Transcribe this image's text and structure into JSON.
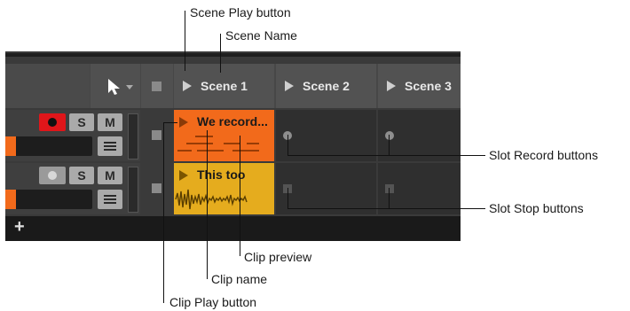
{
  "annotations": {
    "scene_play_button": "Scene Play button",
    "scene_name": "Scene Name",
    "slot_record_buttons": "Slot Record buttons",
    "slot_stop_buttons": "Slot Stop buttons",
    "clip_preview": "Clip preview",
    "clip_name": "Clip name",
    "clip_play_button": "Clip Play button"
  },
  "scenes": [
    {
      "name": "Scene 1"
    },
    {
      "name": "Scene 2"
    },
    {
      "name": "Scene 3"
    }
  ],
  "tracks": [
    {
      "solo_label": "S",
      "mute_label": "M",
      "armed": true
    },
    {
      "solo_label": "S",
      "mute_label": "M",
      "armed": false
    }
  ],
  "clips": [
    {
      "name": "We record...",
      "color": "#f26a1b"
    },
    {
      "name": "This too",
      "color": "#e5ac1e"
    }
  ],
  "add_track_label": "+",
  "colors": {
    "record_active": "#e0161a",
    "clip_orange": "#f26a1b",
    "clip_yellow": "#e5ac1e"
  },
  "icons": {
    "pointer": "arrow-pointer-icon",
    "play": "triangle-play-icon",
    "stop": "square-stop-icon",
    "record": "circle-record-icon"
  }
}
